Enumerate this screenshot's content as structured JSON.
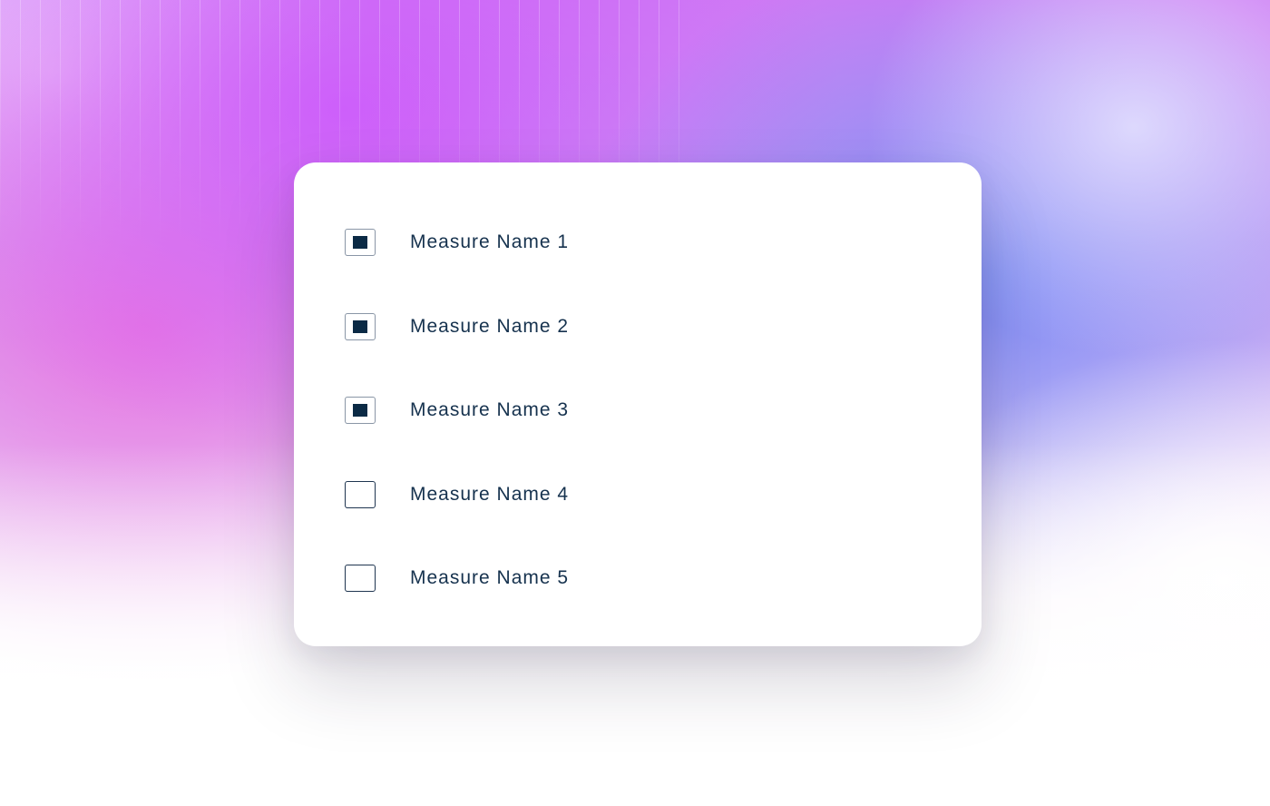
{
  "colors": {
    "checkbox_fill": "#0b2a45",
    "label_text": "#16324e",
    "card_background": "#ffffff"
  },
  "measures": [
    {
      "label": "Measure Name 1",
      "checked": true
    },
    {
      "label": "Measure Name 2",
      "checked": true
    },
    {
      "label": "Measure Name 3",
      "checked": true
    },
    {
      "label": "Measure Name 4",
      "checked": false
    },
    {
      "label": "Measure Name 5",
      "checked": false
    }
  ]
}
